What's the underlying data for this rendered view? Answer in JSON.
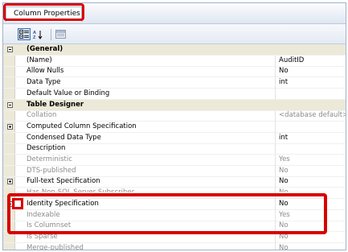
{
  "window": {
    "title": "Column Properties"
  },
  "toolbar": {
    "buttons": [
      {
        "icon": "categorized-icon",
        "active": true
      },
      {
        "icon": "alphabetical-sort-icon",
        "active": false
      },
      {
        "icon": "property-pages-icon",
        "active": false
      }
    ]
  },
  "properties": [
    {
      "type": "category",
      "label": "(General)",
      "expander": "minus"
    },
    {
      "label": "(Name)",
      "value": "AuditID"
    },
    {
      "label": "Allow Nulls",
      "value": "No"
    },
    {
      "label": "Data Type",
      "value": "int"
    },
    {
      "label": "Default Value or Binding",
      "value": ""
    },
    {
      "type": "category",
      "label": "Table Designer",
      "expander": "minus"
    },
    {
      "label": "Collation",
      "value": "<database default>",
      "disabled": true
    },
    {
      "label": "Computed Column Specification",
      "value": "",
      "expander": "plus"
    },
    {
      "label": "Condensed Data Type",
      "value": "int"
    },
    {
      "label": "Description",
      "value": ""
    },
    {
      "label": "Deterministic",
      "value": "Yes",
      "disabled": true
    },
    {
      "label": "DTS-published",
      "value": "No",
      "disabled": true
    },
    {
      "label": "Full-text Specification",
      "value": "No",
      "expander": "plus"
    },
    {
      "label": "Has Non-SQL Server Subscriber",
      "value": "No",
      "disabled": true,
      "obscured": true
    },
    {
      "label": "Identity Specification",
      "value": "No",
      "expander": "plus"
    },
    {
      "label": "Indexable",
      "value": "Yes",
      "disabled": true
    },
    {
      "label": "Is Columnset",
      "value": "No",
      "disabled": true
    },
    {
      "label": "Is Sparse",
      "value": "No",
      "disabled": true
    },
    {
      "label": "Merge-published",
      "value": "No",
      "disabled": true
    }
  ],
  "highlight_color": "#d80000"
}
